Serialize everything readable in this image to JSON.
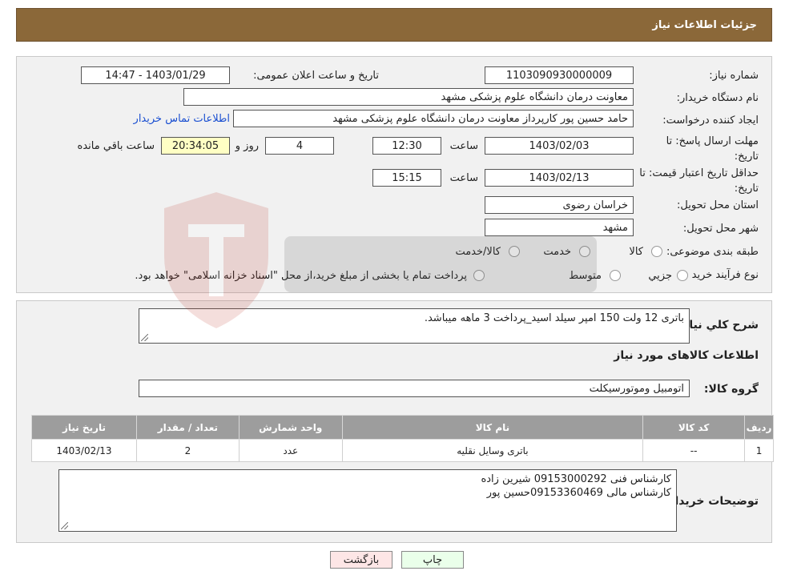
{
  "header": {
    "title": "جزئیات اطلاعات نیاز"
  },
  "form": {
    "need_number_label": "شماره نیاز:",
    "need_number": "1103090930000009",
    "announce_label": "تاریخ و ساعت اعلان عمومی:",
    "announce_value": "1403/01/29 - 14:47",
    "buyer_org_label": "نام دستگاه خریدار:",
    "buyer_org": "معاونت درمان دانشگاه علوم پزشکی مشهد",
    "creator_label": "ایجاد کننده درخواست:",
    "creator": "حامد حسین پور کارپرداز معاونت درمان دانشگاه علوم پزشکی مشهد",
    "contact_link": "اطلاعات تماس خریدار",
    "deadline_label": "مهلت ارسال پاسخ: تا تاریخ:",
    "deadline_date": "1403/02/03",
    "time_label": "ساعت",
    "deadline_time": "12:30",
    "days_value": "4",
    "days_label": "روز و",
    "remaining_time": "20:34:05",
    "remaining_label": "ساعت باقي مانده",
    "validity_label": "حداقل تاریخ اعتبار قیمت: تا تاریخ:",
    "validity_date": "1403/02/13",
    "validity_time": "15:15",
    "province_label": "استان محل تحویل:",
    "province": "خراسان رضوی",
    "city_label": "شهر محل تحویل:",
    "city": "مشهد",
    "category_label": "طبقه بندی موضوعی:",
    "category_options": [
      "کالا",
      "خدمت",
      "کالا/خدمت"
    ],
    "purchase_type_label": "نوع فرآیند خرید :",
    "purchase_type_options": [
      "جزیي",
      "متوسط"
    ],
    "purchase_note": "پرداخت تمام یا بخشی از مبلغ خرید،از محل \"اسناد خزانه اسلامی\" خواهد بود."
  },
  "details": {
    "summary_label": "شرح كلي نياز:",
    "summary": "باتری 12 ولت 150 امپر سیلد اسید_پرداخت 3 ماهه میباشد.",
    "goods_info_title": "اطلاعات کالاهای مورد نیاز",
    "goods_group_label": "گروه کالا:",
    "goods_group": "اتومبیل وموتورسیکلت",
    "table": {
      "headers": [
        "ردیف",
        "کد کالا",
        "نام کالا",
        "واحد شمارش",
        "تعداد / مقدار",
        "تاریخ نیاز"
      ],
      "rows": [
        [
          "1",
          "--",
          "باتری وسایل نقلیه",
          "عدد",
          "2",
          "1403/02/13"
        ]
      ]
    },
    "buyer_notes_label": "توضیحات خریدار:",
    "buyer_notes_line1": "کارشناس فنی 09153000292 شیرین زاده",
    "buyer_notes_line2": "کارشناس مالی 09153360469حسین پور"
  },
  "buttons": {
    "print": "چاپ",
    "back": "بازگشت"
  },
  "colors": {
    "header_bg": "#8b6839",
    "table_header_bg": "#9d9d9d",
    "yellow_box": "#ffffc4",
    "link": "#1a4fd1"
  }
}
